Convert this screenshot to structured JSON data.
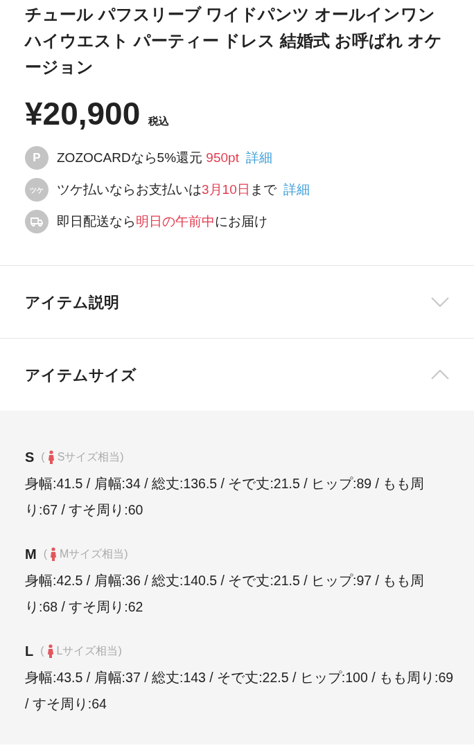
{
  "title_lines": [
    "チュール パフスリーブ ワイドパンツ オールインワン",
    "ハイウエスト パーティー ドレス 結婚式 お呼ばれ オケ",
    "ージョン"
  ],
  "price": {
    "amount": "¥20,900",
    "tax": "税込"
  },
  "info": [
    {
      "kind": "points",
      "badge": "P",
      "parts": [
        {
          "kind": "plain",
          "text": "ZOZOCARDなら5%還元 "
        },
        {
          "kind": "highlight",
          "text": "950pt"
        },
        {
          "kind": "link",
          "text": "詳細"
        }
      ]
    },
    {
      "kind": "tsuke",
      "badge": "ツケ",
      "parts": [
        {
          "kind": "plain",
          "text": "ツケ払いならお支払いは"
        },
        {
          "kind": "highlight",
          "text": "3月10日"
        },
        {
          "kind": "plain",
          "text": "まで"
        },
        {
          "kind": "link",
          "text": "詳細"
        }
      ]
    },
    {
      "kind": "truck",
      "parts": [
        {
          "kind": "plain",
          "text": "即日配送なら"
        },
        {
          "kind": "highlight",
          "text": "明日の午前中"
        },
        {
          "kind": "plain",
          "text": "にお届け"
        }
      ]
    }
  ],
  "sections": [
    {
      "label": "アイテム説明",
      "expanded": false
    },
    {
      "label": "アイテムサイズ",
      "expanded": true
    }
  ],
  "sizes": [
    {
      "label": "S",
      "paren_open": "(",
      "note": "Sサイズ相当",
      "paren_close": ")",
      "measurements": "身幅:41.5 / 肩幅:34 / 総丈:136.5 / そで丈:21.5 / ヒップ:89 / もも周り:67 / すそ周り:60"
    },
    {
      "label": "M",
      "paren_open": "(",
      "note": "Mサイズ相当",
      "paren_close": ")",
      "measurements": "身幅:42.5 / 肩幅:36 / 総丈:140.5 / そで丈:21.5 / ヒップ:97 / もも周り:68 / すそ周り:62"
    },
    {
      "label": "L",
      "paren_open": "(",
      "note": "Lサイズ相当",
      "paren_close": ")",
      "measurements": "身幅:43.5 / 肩幅:37 / 総丈:143 / そで丈:22.5 / ヒップ:100 / もも周り:69 / すそ周り:64"
    }
  ]
}
